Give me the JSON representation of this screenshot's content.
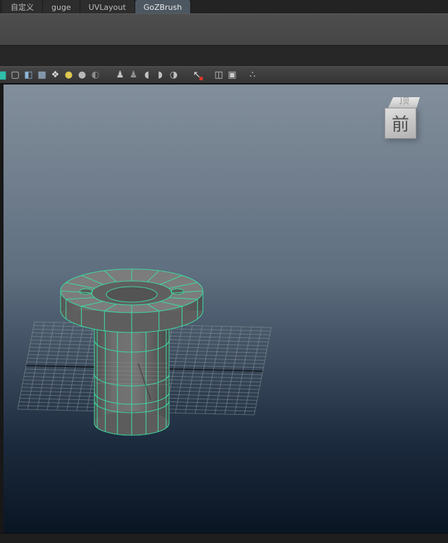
{
  "shelf_tabs": {
    "items": [
      {
        "label": "自定义",
        "active": false
      },
      {
        "label": "guge",
        "active": false
      },
      {
        "label": "UVLayout",
        "active": false
      },
      {
        "label": "GoZBrush",
        "active": true
      }
    ]
  },
  "panel_toolbar": {
    "items": [
      {
        "type": "icon",
        "name": "ghost-color-swatch-icon",
        "glyph": "■",
        "color": "#2fc0ac",
        "edge": true
      },
      {
        "type": "icon",
        "name": "wireframe-cube-icon",
        "glyph": "▢",
        "color": "#cccccc"
      },
      {
        "type": "icon",
        "name": "shaded-cube-icon",
        "glyph": "◧",
        "color": "#8fb4d9"
      },
      {
        "type": "icon",
        "name": "textured-cube-icon",
        "glyph": "▦",
        "color": "#a6c6e2"
      },
      {
        "type": "icon",
        "name": "checker-icon",
        "glyph": "❖",
        "color": "#d8d8d8"
      },
      {
        "type": "icon",
        "name": "use-all-lights-icon",
        "glyph": "●",
        "color": "#dcc84f"
      },
      {
        "type": "icon",
        "name": "default-light-icon",
        "glyph": "●",
        "color": "#b8b8b8"
      },
      {
        "type": "icon",
        "name": "shadows-icon",
        "glyph": "◐",
        "color": "#8d8d8d"
      },
      {
        "type": "gap",
        "width": 14
      },
      {
        "type": "icon",
        "name": "xray-icon",
        "glyph": "♟",
        "color": "#c2c2c2"
      },
      {
        "type": "icon",
        "name": "xray-joints-icon",
        "glyph": "♟",
        "color": "#8f8f8f"
      },
      {
        "type": "icon",
        "name": "isolate-select-left-icon",
        "glyph": "◖",
        "color": "#c2c2c2"
      },
      {
        "type": "icon",
        "name": "isolate-select-right-icon",
        "glyph": "◗",
        "color": "#c2c2c2"
      },
      {
        "type": "icon",
        "name": "exposure-sphere-icon",
        "glyph": "◑",
        "color": "#c2c2c2"
      },
      {
        "type": "gap",
        "width": 12
      },
      {
        "type": "icon",
        "name": "highlight-selection-icon",
        "glyph": "↖",
        "color": "#e0e0e0",
        "dot": "#d8392c"
      },
      {
        "type": "gap",
        "width": 10
      },
      {
        "type": "icon",
        "name": "camera-cube-icon",
        "glyph": "◫",
        "color": "#cccccc"
      },
      {
        "type": "icon",
        "name": "frame-cube-icon",
        "glyph": "▣",
        "color": "#cccccc"
      },
      {
        "type": "gap",
        "width": 8
      },
      {
        "type": "icon",
        "name": "node-connections-icon",
        "glyph": "∴",
        "color": "#cccccc"
      }
    ]
  },
  "viewport": {
    "view_cube": {
      "front_label": "前",
      "top_label": "顶"
    },
    "colors": {
      "sky_top": "#828e9b",
      "sky_mid": "#5f6f80",
      "sky_deep": "#1b2a3d",
      "sky_bottom": "#0a1523",
      "wireframe": "#3fd8a0",
      "surface_top": "#7c7c7c",
      "surface_side": "#676767",
      "grid_line": "#9aa1a4",
      "grid_axis": "#0d0d0d"
    }
  }
}
